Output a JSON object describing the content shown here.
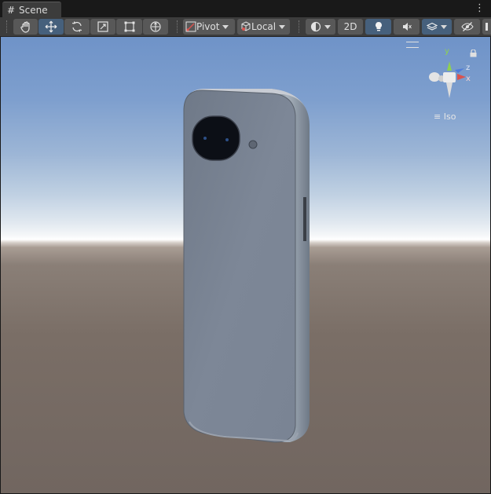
{
  "window": {
    "tab_title": "Scene",
    "tab_icon": "hash-icon",
    "menu_icon": "kebab-menu-icon"
  },
  "toolbar": {
    "tools": [
      {
        "name": "hand-tool",
        "active": false
      },
      {
        "name": "move-tool",
        "active": true
      },
      {
        "name": "rotate-tool",
        "active": false
      },
      {
        "name": "scale-tool",
        "active": false
      },
      {
        "name": "rect-tool",
        "active": false
      },
      {
        "name": "transform-tool",
        "active": false
      }
    ],
    "pivot_label": "Pivot",
    "local_label": "Local",
    "mode_2d_label": "2D",
    "lighting_active": true
  },
  "gizmo": {
    "y_label": "y",
    "z_label": "z",
    "x_label": "x",
    "projection_label": "Iso"
  },
  "colors": {
    "accent": "#46607c",
    "toolbar_bg": "#3c3c3c",
    "button_bg": "#585858",
    "sky_top": "#6f93c8",
    "horizon": "#ffffff",
    "ground": "#716660",
    "phone_body": "#7b8595"
  }
}
